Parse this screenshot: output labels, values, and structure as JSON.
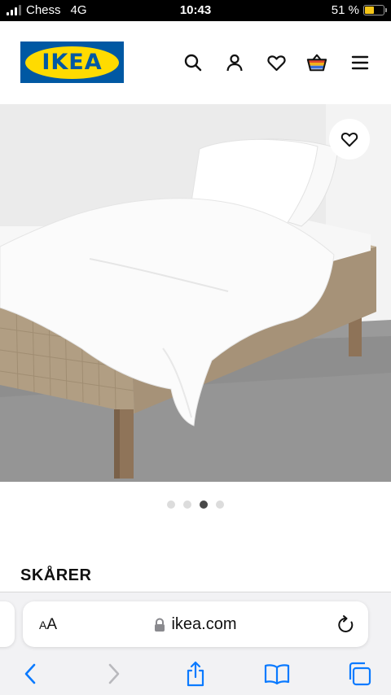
{
  "status": {
    "carrier": "Chess",
    "network": "4G",
    "time": "10:43",
    "battery": "51 %",
    "battery_level": 0.51
  },
  "header": {
    "logo_text": "IKEA",
    "icons": [
      "search-icon",
      "user-icon",
      "heart-icon",
      "basket-icon",
      "menu-icon"
    ]
  },
  "gallery": {
    "dots": [
      false,
      false,
      true,
      false
    ],
    "favorite_icon": "heart-icon"
  },
  "product": {
    "name": "SKÅRER"
  },
  "browser": {
    "aa_label_big": "A",
    "aa_label_small": "A",
    "url": "ikea.com",
    "toolbar": [
      "back-icon",
      "forward-icon",
      "share-icon",
      "bookmarks-icon",
      "tabs-icon"
    ]
  },
  "colors": {
    "ikea_blue": "#0058a3",
    "ikea_yellow": "#ffdb00",
    "ios_blue": "#0a7aff"
  }
}
